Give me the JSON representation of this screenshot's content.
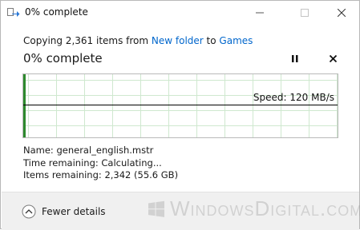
{
  "window": {
    "title": "0% complete"
  },
  "header": {
    "copy_prefix": "Copying 2,361 items from ",
    "source": "New folder",
    "copy_mid": " to ",
    "destination": "Games",
    "percent_title": "0% complete",
    "progress_percent": 0
  },
  "graph": {
    "speed_label": "Speed: 120 MB/s"
  },
  "details": {
    "name_label": "Name:",
    "name_value": "general_english.mstr",
    "time_label": "Time remaining:",
    "time_value": "Calculating...",
    "items_label": "Items remaining:",
    "items_value": "2,342 (55.6 GB)"
  },
  "footer": {
    "fewer_details_label": "Fewer details"
  },
  "watermark": {
    "text": "WindowsDigital.com"
  },
  "colors": {
    "link": "#0066cc",
    "graph_grid": "#cfe8cf",
    "graph_bar": "#2d8a2d",
    "footer_bg": "#f0f0f0"
  }
}
